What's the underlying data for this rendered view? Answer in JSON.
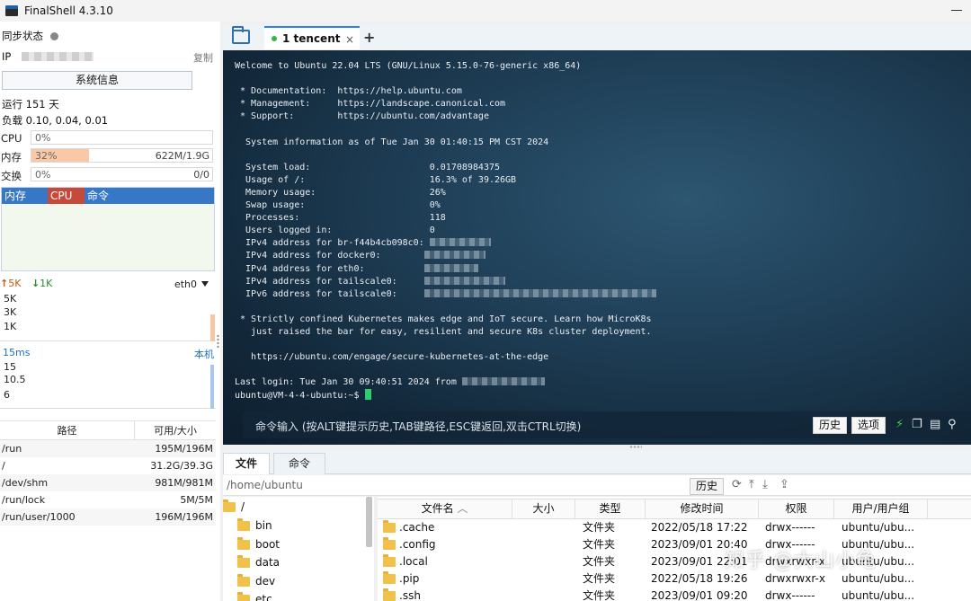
{
  "app": {
    "title": "FinalShell 4.3.10"
  },
  "left": {
    "sync_label": "同步状态",
    "ip_label": "IP",
    "copy_label": "复制",
    "sysinfo_button": "系统信息",
    "uptime": "运行 151 天",
    "load": "负载 0.10, 0.04, 0.01",
    "cpu": {
      "label": "CPU",
      "pct_text": "0%",
      "fraction": 0.0
    },
    "mem": {
      "label": "内存",
      "pct_text": "32%",
      "fraction": 0.32,
      "amount": "622M/1.9G"
    },
    "swap": {
      "label": "交换",
      "pct_text": "0%",
      "fraction": 0.0,
      "amount": "0/0"
    },
    "proc_headers": [
      "内存",
      "CPU",
      "命令"
    ],
    "net": {
      "up": "5K",
      "down": "1K",
      "iface": "eth0",
      "ticks": [
        "5K",
        "3K",
        "1K"
      ]
    },
    "ping": {
      "latency": "15ms",
      "location": "本机",
      "ticks": [
        "15",
        "10.5",
        "6"
      ]
    },
    "dirs": {
      "headers": [
        "路径",
        "可用/大小"
      ],
      "rows": [
        {
          "path": "/run",
          "size": "195M/196M"
        },
        {
          "path": "/",
          "size": "31.2G/39.3G"
        },
        {
          "path": "/dev/shm",
          "size": "981M/981M"
        },
        {
          "path": "/run/lock",
          "size": "5M/5M"
        },
        {
          "path": "/run/user/1000",
          "size": "196M/196M"
        }
      ]
    }
  },
  "tabs": {
    "active_label": "1 tencent",
    "close_glyph": "×",
    "add_glyph": "+"
  },
  "terminal": {
    "welcome": "Welcome to Ubuntu 22.04 LTS (GNU/Linux 5.15.0-76-generic x86_64)",
    "doc": " * Documentation:  https://help.ubuntu.com",
    "mgmt": " * Management:     https://landscape.canonical.com",
    "support": " * Support:        https://ubuntu.com/advantage",
    "sysinfo": "  System information as of Tue Jan 30 01:40:15 PM CST 2024",
    "load": "  System load:                      0.01708984375",
    "usage": "  Usage of /:                       16.3% of 39.26GB",
    "memory": "  Memory usage:                     26%",
    "swap": "  Swap usage:                       0%",
    "procs": "  Processes:                        118",
    "users": "  Users logged in:                  0",
    "ipv4_br": "  IPv4 address for br-f44b4cb098c0: ",
    "ipv4_docker": "  IPv4 address for docker0:        ",
    "ipv4_eth": "  IPv4 address for eth0:           ",
    "ipv4_ts": "  IPv4 address for tailscale0:     ",
    "ipv6_ts": "  IPv6 address for tailscale0:     ",
    "k8s1": " * Strictly confined Kubernetes makes edge and IoT secure. Learn how MicroK8s",
    "k8s2": "   just raised the bar for easy, resilient and secure K8s cluster deployment.",
    "k8s_url": "   https://ubuntu.com/engage/secure-kubernetes-at-the-edge",
    "last_login": "Last login: Tue Jan 30 09:40:51 2024 from ",
    "prompt": "ubuntu@VM-4-4-ubuntu:~$ "
  },
  "cmdbar": {
    "placeholder": "命令输入 (按ALT键提示历史,TAB键路径,ESC键返回,双击CTRL切换)",
    "history": "历史",
    "options": "选项"
  },
  "files": {
    "tab_files": "文件",
    "tab_commands": "命令",
    "path": "/home/ubuntu",
    "history_button": "历史",
    "tree_root": "/",
    "tree": [
      "bin",
      "boot",
      "data",
      "dev",
      "etc"
    ],
    "headers": [
      "文件名",
      "大小",
      "类型",
      "修改时间",
      "权限",
      "用户/用户组"
    ],
    "rows": [
      {
        "name": ".cache",
        "type": "文件夹",
        "mtime": "2022/05/18 17:22",
        "perm": "drwx------",
        "owner": "ubuntu/ubu..."
      },
      {
        "name": ".config",
        "type": "文件夹",
        "mtime": "2023/09/01 20:40",
        "perm": "drwx------",
        "owner": "ubuntu/ubu..."
      },
      {
        "name": ".local",
        "type": "文件夹",
        "mtime": "2023/09/01 22:01",
        "perm": "drwxrwxr-x",
        "owner": "ubuntu/ubu..."
      },
      {
        "name": ".pip",
        "type": "文件夹",
        "mtime": "2022/05/18 19:26",
        "perm": "drwxrwxr-x",
        "owner": "ubuntu/ubu..."
      },
      {
        "name": ".ssh",
        "type": "文件夹",
        "mtime": "2023/09/01 09:20",
        "perm": "drwx------",
        "owner": "ubuntu/ubu..."
      }
    ]
  },
  "watermark": "知乎 @大山小龟",
  "colors": {
    "accent": "#3778c6",
    "cpu_header": "#c64a3a",
    "mem_fill": "#f9c9a7",
    "cursor": "#2ecc71"
  }
}
